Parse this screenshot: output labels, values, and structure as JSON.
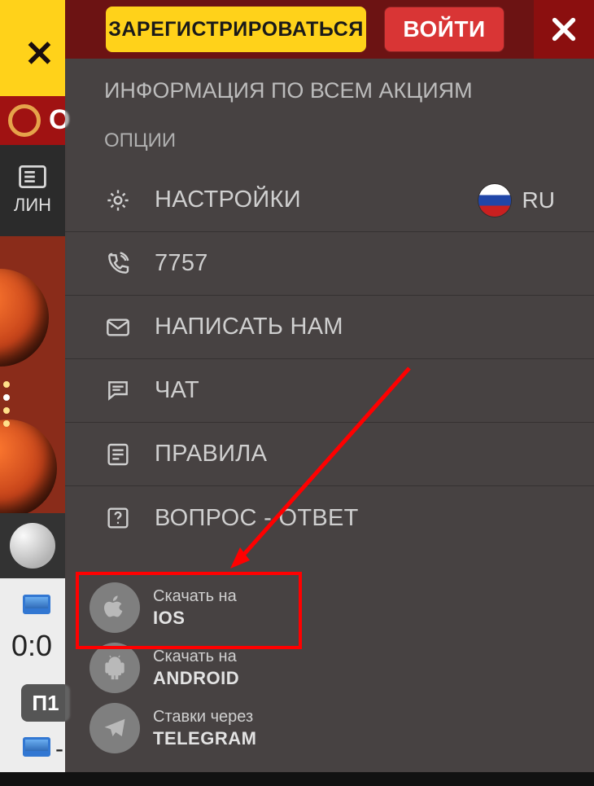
{
  "header": {
    "register": "ЗАРЕГИСТРИРОВАТЬСЯ",
    "login": "ВОЙТИ"
  },
  "promo_title": "ИНФОРМАЦИЯ ПО ВСЕМ АКЦИЯМ",
  "section_options": "ОПЦИИ",
  "menu": {
    "settings": "НАСТРОЙКИ",
    "phone": "7757",
    "contact": "НАПИСАТЬ НАМ",
    "chat": "ЧАТ",
    "rules": "ПРАВИЛА",
    "faq": "ВОПРОС - ОТВЕТ"
  },
  "lang_code": "RU",
  "apps": {
    "download_on": "Скачать на",
    "ios": "IOS",
    "android": "ANDROID",
    "bets_via": "Ставки через",
    "telegram": "TELEGRAM"
  },
  "bg": {
    "brand_letter": "О",
    "tab": "ЛИН",
    "score": "0:0",
    "p1": "П1",
    "dash": "-"
  }
}
